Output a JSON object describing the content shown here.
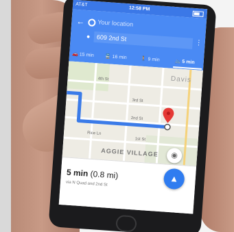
{
  "status": {
    "carrier": "AT&T",
    "time": "12:58 PM"
  },
  "search": {
    "origin": "Your location",
    "destination": "609 2nd St"
  },
  "modes": [
    {
      "label": "15 min",
      "icon": "car-icon"
    },
    {
      "label": "16 min",
      "icon": "transit-icon"
    },
    {
      "label": "9 min",
      "icon": "walk-icon"
    },
    {
      "label": "5 min",
      "icon": "bike-icon",
      "active": true
    }
  ],
  "map": {
    "labels": {
      "street_4th": "4th St",
      "street_3rd": "3rd St",
      "street_2nd": "2nd St",
      "rice_ln": "Rice Ln",
      "first_st": "1st St",
      "aggie_village": "AGGIE VILLAGE",
      "davis": "Davis"
    },
    "route_color": "#3b7be8",
    "pin_color": "#e53935"
  },
  "route": {
    "duration": "5 min",
    "distance": "(0.8 mi)",
    "via": "via N Quad and 2nd St"
  }
}
